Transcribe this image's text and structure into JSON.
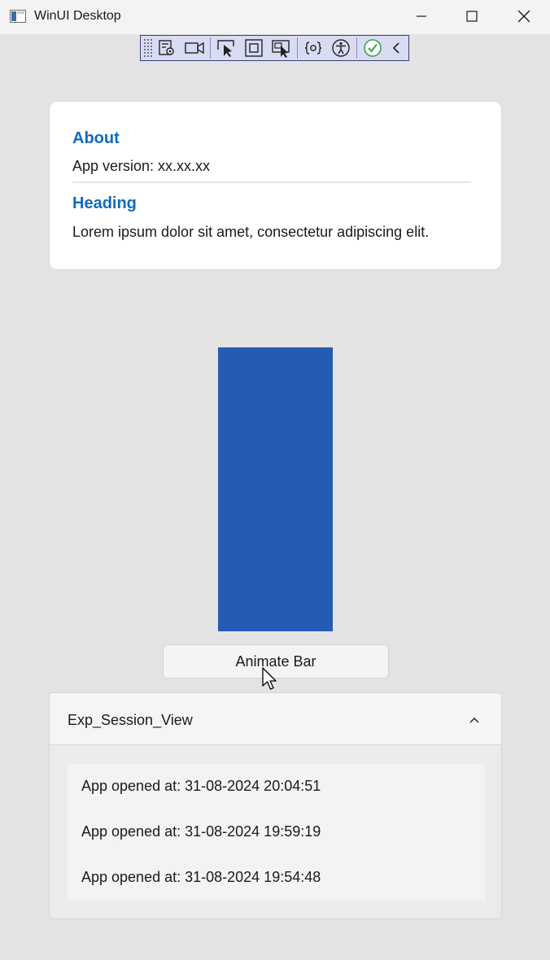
{
  "window": {
    "title": "WinUI Desktop",
    "icons": [
      "app-icon",
      "minimize-icon",
      "maximize-icon",
      "close-icon"
    ]
  },
  "devbar": {
    "icons": [
      "grip-icon",
      "visual-tree-icon",
      "record-icon",
      "select-element-icon",
      "display-layout-adorners-icon",
      "track-focus-icon",
      "hot-reload-icon",
      "accessibility-icon",
      "check-icon",
      "collapse-chevron-icon"
    ],
    "colors": {
      "background": "#d8dcf2",
      "border": "#3c3c78",
      "check": "#3aa34a"
    }
  },
  "about": {
    "heading": "About",
    "version_text": "App version: xx.xx.xx",
    "section_heading": "Heading",
    "body_text": "Lorem ipsum dolor sit amet, consectetur adipiscing elit."
  },
  "bar": {
    "color": "#255bb3"
  },
  "animate_button": {
    "label": "Animate Bar"
  },
  "expander": {
    "title": "Exp_Session_View",
    "expanded": true,
    "chevron_icon": "chevron-up-icon",
    "sessions": [
      {
        "text": "App opened at: 31-08-2024 20:04:51"
      },
      {
        "text": "App opened at: 31-08-2024 19:59:19"
      },
      {
        "text": "App opened at: 31-08-2024 19:54:48"
      }
    ]
  },
  "colors": {
    "accent_heading": "#0f6cbd",
    "page_background": "#e3e3e3",
    "card_background": "#ffffff"
  }
}
